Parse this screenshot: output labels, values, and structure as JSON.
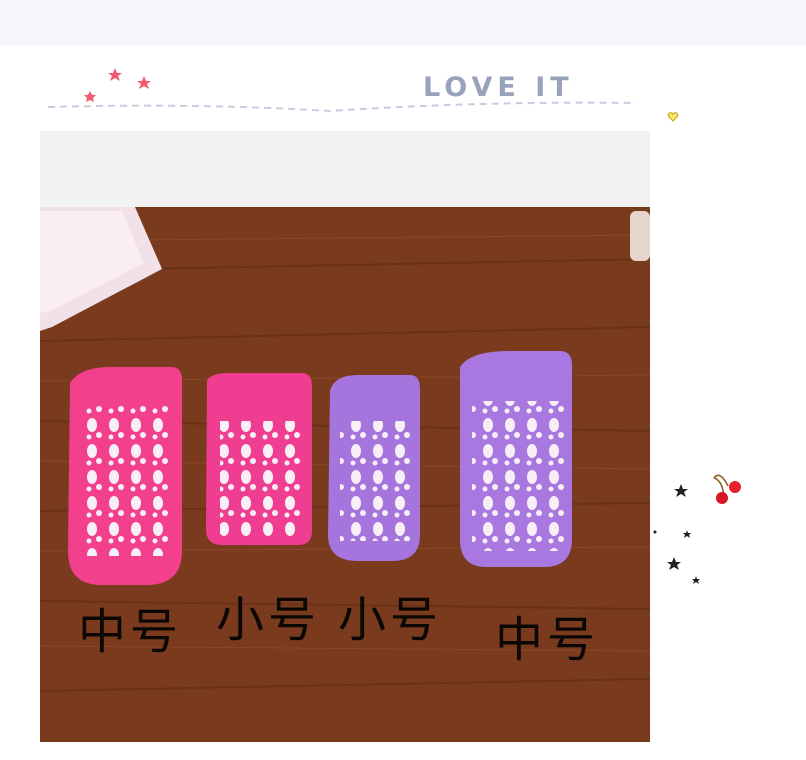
{
  "banner": {
    "heading": "LOVE IT"
  },
  "photo": {
    "subject": "four non-slip children's socks on a wooden table",
    "labels": [
      "中号",
      "小号",
      "小号",
      "中号"
    ],
    "sock_colors": [
      "#f2408d",
      "#ef3e92",
      "#a574dd",
      "#a878e0"
    ],
    "table_color": "#7a3a1e"
  },
  "colors": {
    "accent_heading": "#98a2bb",
    "dashed_line": "#c5cde0",
    "star_pink": "#ef5a6f"
  }
}
